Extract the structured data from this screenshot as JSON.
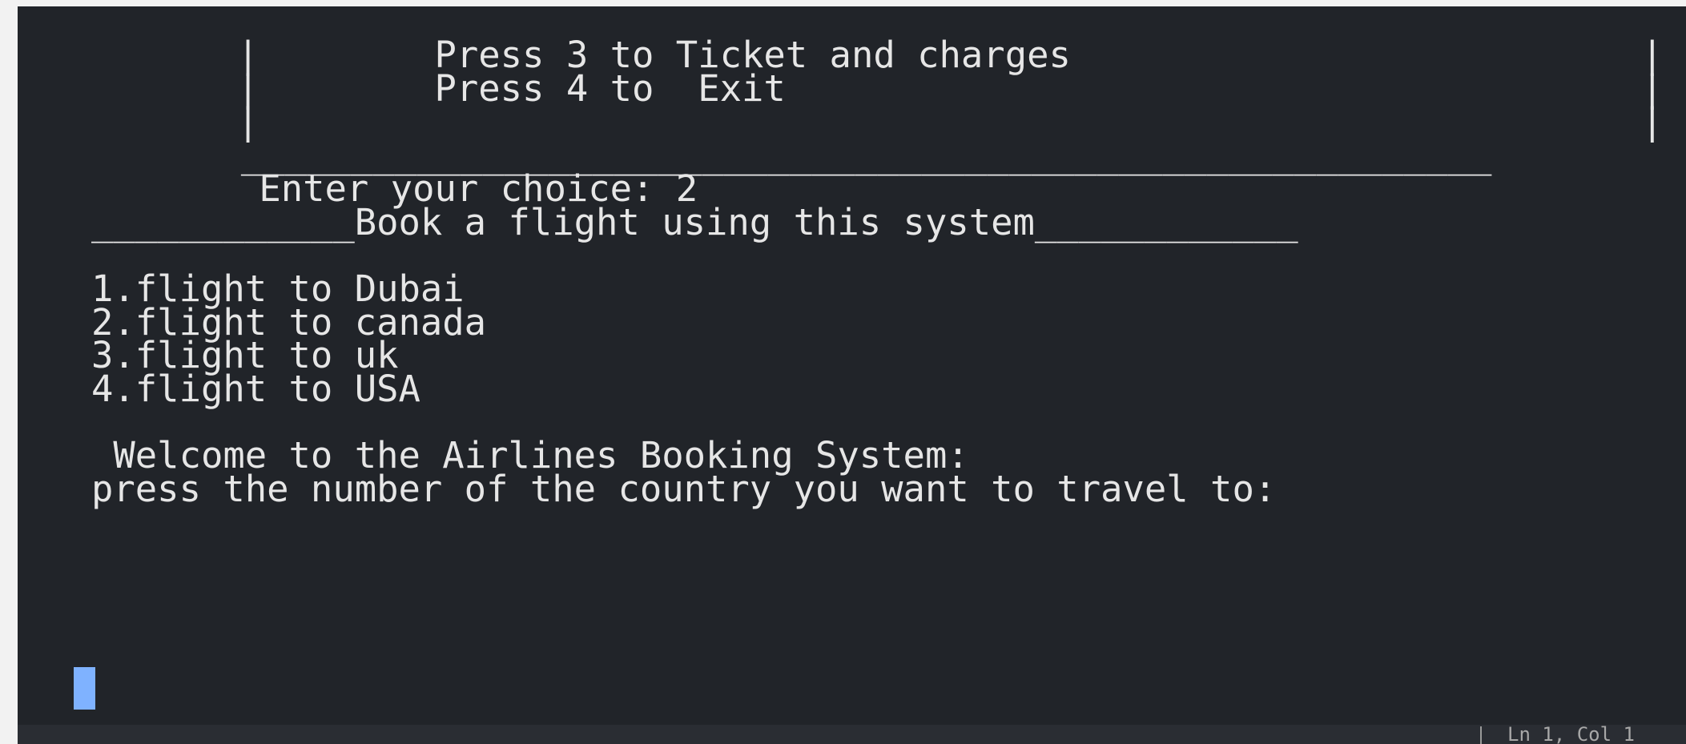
{
  "terminal": {
    "menu_lines": [
      "          |        Press 3 to Ticket and charges                          |",
      "          |        Press 4 to  Exit                                       |",
      "          |                                                               |"
    ],
    "menu_rule": "          _________________________________________________________",
    "prompt_line": "           Enter your choice: 2",
    "section_header": "____________Book a flight using this system____________",
    "options": [
      "1.flight to Dubai",
      "2.flight to canada",
      "3.flight to uk",
      "4.flight to USA"
    ],
    "welcome_line": " Welcome to the Airlines Booking System:",
    "country_prompt": "press the number of the country you want to travel to:"
  },
  "status_bar": {
    "right_text": "Ln 1, Col 1"
  },
  "colors": {
    "background": "#212429",
    "text": "#e6e6e6",
    "cursor": "#7fb2ff"
  }
}
